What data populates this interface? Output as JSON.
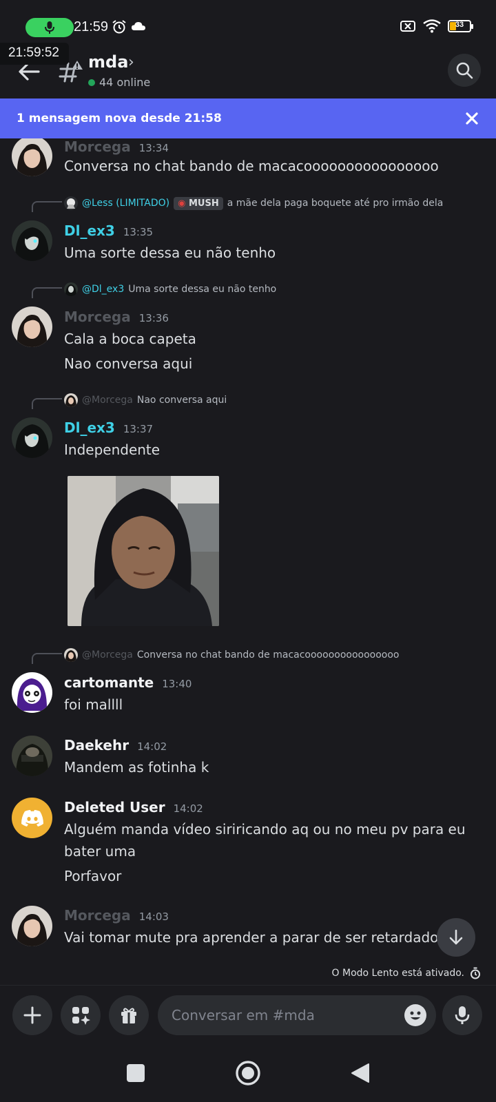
{
  "status_bar": {
    "time": "21:59"
  },
  "clock_overlay": "21:59:52",
  "battery": {
    "level": "33",
    "level_fraction": 0.33
  },
  "header": {
    "channel_name": "mda",
    "online": "44 online"
  },
  "banner": {
    "text": "1 mensagem nova desde 21:58"
  },
  "messages": [
    {
      "username": "Morcega",
      "time": "13:34",
      "lines": [
        "Conversa no chat bando de macacoooooooooooooooo"
      ]
    },
    {
      "reply": {
        "mention": "@Less (LIMITADO)",
        "tag": "MUSH",
        "text": "a mãe dela paga boquete até pro irmão dela"
      },
      "username": "Dl_ex3",
      "time": "13:35",
      "lines": [
        "Uma sorte dessa eu não tenho"
      ]
    },
    {
      "reply": {
        "mention": "@Dl_ex3",
        "text": "Uma sorte dessa eu não tenho"
      },
      "username": "Morcega",
      "time": "13:36",
      "lines": [
        "Cala a boca capeta",
        "Nao conversa aqui"
      ]
    },
    {
      "reply": {
        "mention": "@Morcega",
        "text": "Nao conversa aqui"
      },
      "username": "Dl_ex3",
      "time": "13:37",
      "lines": [
        "Independente"
      ]
    },
    {
      "reply": {
        "mention": "@Morcega",
        "text": "Conversa no chat bando de macacoooooooooooooooo"
      },
      "username": "cartomante",
      "time": "13:40",
      "lines": [
        "foi mallll"
      ]
    },
    {
      "username": "Daekehr",
      "time": "14:02",
      "lines": [
        "Mandem as fotinha k"
      ]
    },
    {
      "username": "Deleted User",
      "time": "14:02",
      "lines": [
        "Alguém manda vídeo siriricando aq ou no meu pv para eu",
        "bater uma",
        "Porfavor"
      ]
    },
    {
      "username": "Morcega",
      "time": "14:03",
      "lines": [
        "Vai tomar mute pra aprender a parar de ser retardado"
      ]
    }
  ],
  "slowmode": "O Modo Lento está ativado.",
  "composer": {
    "placeholder": "Conversar em #mda"
  },
  "colors": {
    "accent": "#5865f2",
    "background": "#1a1a1e",
    "username_teal": "#3fd0e6",
    "online": "#23a55a"
  }
}
